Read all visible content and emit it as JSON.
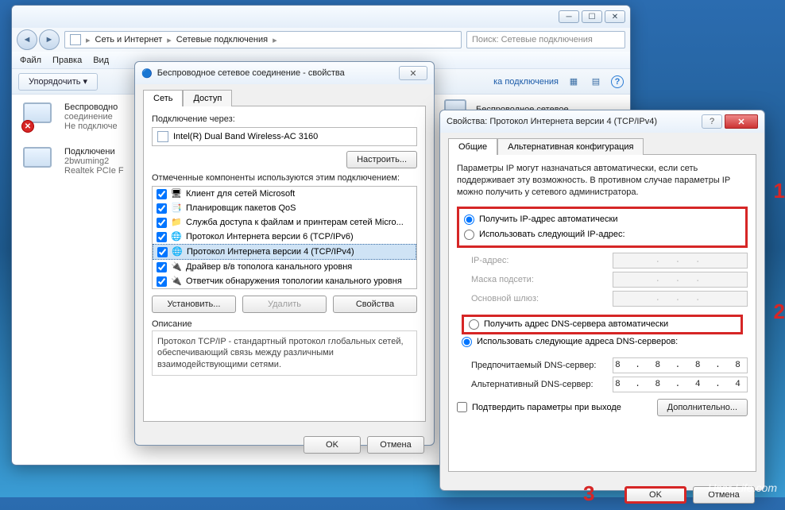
{
  "explorer": {
    "breadcrumb": [
      "Сеть и Интернет",
      "Сетевые подключения"
    ],
    "search_placeholder": "Поиск: Сетевые подключения",
    "menu": [
      "Файл",
      "Правка",
      "Вид"
    ],
    "organize_btn": "Упорядочить",
    "toolbar_link": "ка подключения",
    "items": [
      {
        "name": "Беспроводно",
        "line2": "соединение",
        "line3": "Не подключе",
        "has_error": true
      },
      {
        "name": "Подключени",
        "line2": "2bwuming2",
        "line3": "Realtek PCIe F",
        "has_error": false
      }
    ],
    "side_item": "Беспроводное сетевое"
  },
  "dlg1": {
    "title": "Беспроводное сетевое соединение - свойства",
    "tabs": [
      "Сеть",
      "Доступ"
    ],
    "connect_via_label": "Подключение через:",
    "adapter": "Intel(R) Dual Band Wireless-AC 3160",
    "configure_btn": "Настроить...",
    "components_label": "Отмеченные компоненты используются этим подключением:",
    "components": [
      "Клиент для сетей Microsoft",
      "Планировщик пакетов QoS",
      "Служба доступа к файлам и принтерам сетей Micro...",
      "Протокол Интернета версии 6 (TCP/IPv6)",
      "Протокол Интернета версии 4 (TCP/IPv4)",
      "Драйвер в/в тополога канального уровня",
      "Ответчик обнаружения топологии канального уровня"
    ],
    "install_btn": "Установить...",
    "remove_btn": "Удалить",
    "props_btn": "Свойства",
    "desc_label": "Описание",
    "desc_text": "Протокол TCP/IP - стандартный протокол глобальных сетей, обеспечивающий связь между различными взаимодействующими сетями.",
    "ok": "OK",
    "cancel": "Отмена"
  },
  "dlg2": {
    "title": "Свойства: Протокол Интернета версии 4 (TCP/IPv4)",
    "tabs": [
      "Общие",
      "Альтернативная конфигурация"
    ],
    "info": "Параметры IP могут назначаться автоматически, если сеть поддерживает эту возможность. В противном случае параметры IP можно получить у сетевого администратора.",
    "radio_auto_ip": "Получить IP-адрес автоматически",
    "radio_manual_ip": "Использовать следующий IP-адрес:",
    "ip_label": "IP-адрес:",
    "mask_label": "Маска подсети:",
    "gateway_label": "Основной шлюз:",
    "radio_auto_dns": "Получить адрес DNS-сервера автоматически",
    "radio_manual_dns": "Использовать следующие адреса DNS-серверов:",
    "pref_dns_label": "Предпочитаемый DNS-сервер:",
    "alt_dns_label": "Альтернативный DNS-сервер:",
    "pref_dns": "8 . 8 . 8 . 8",
    "alt_dns": "8 . 8 . 4 . 4",
    "validate_label": "Подтвердить параметры при выходе",
    "advanced_btn": "Дополнительно...",
    "ok": "OK",
    "cancel": "Отмена"
  },
  "annotations": {
    "a1": "1",
    "a2": "2",
    "a3": "3"
  },
  "watermark": "User-Life.com"
}
